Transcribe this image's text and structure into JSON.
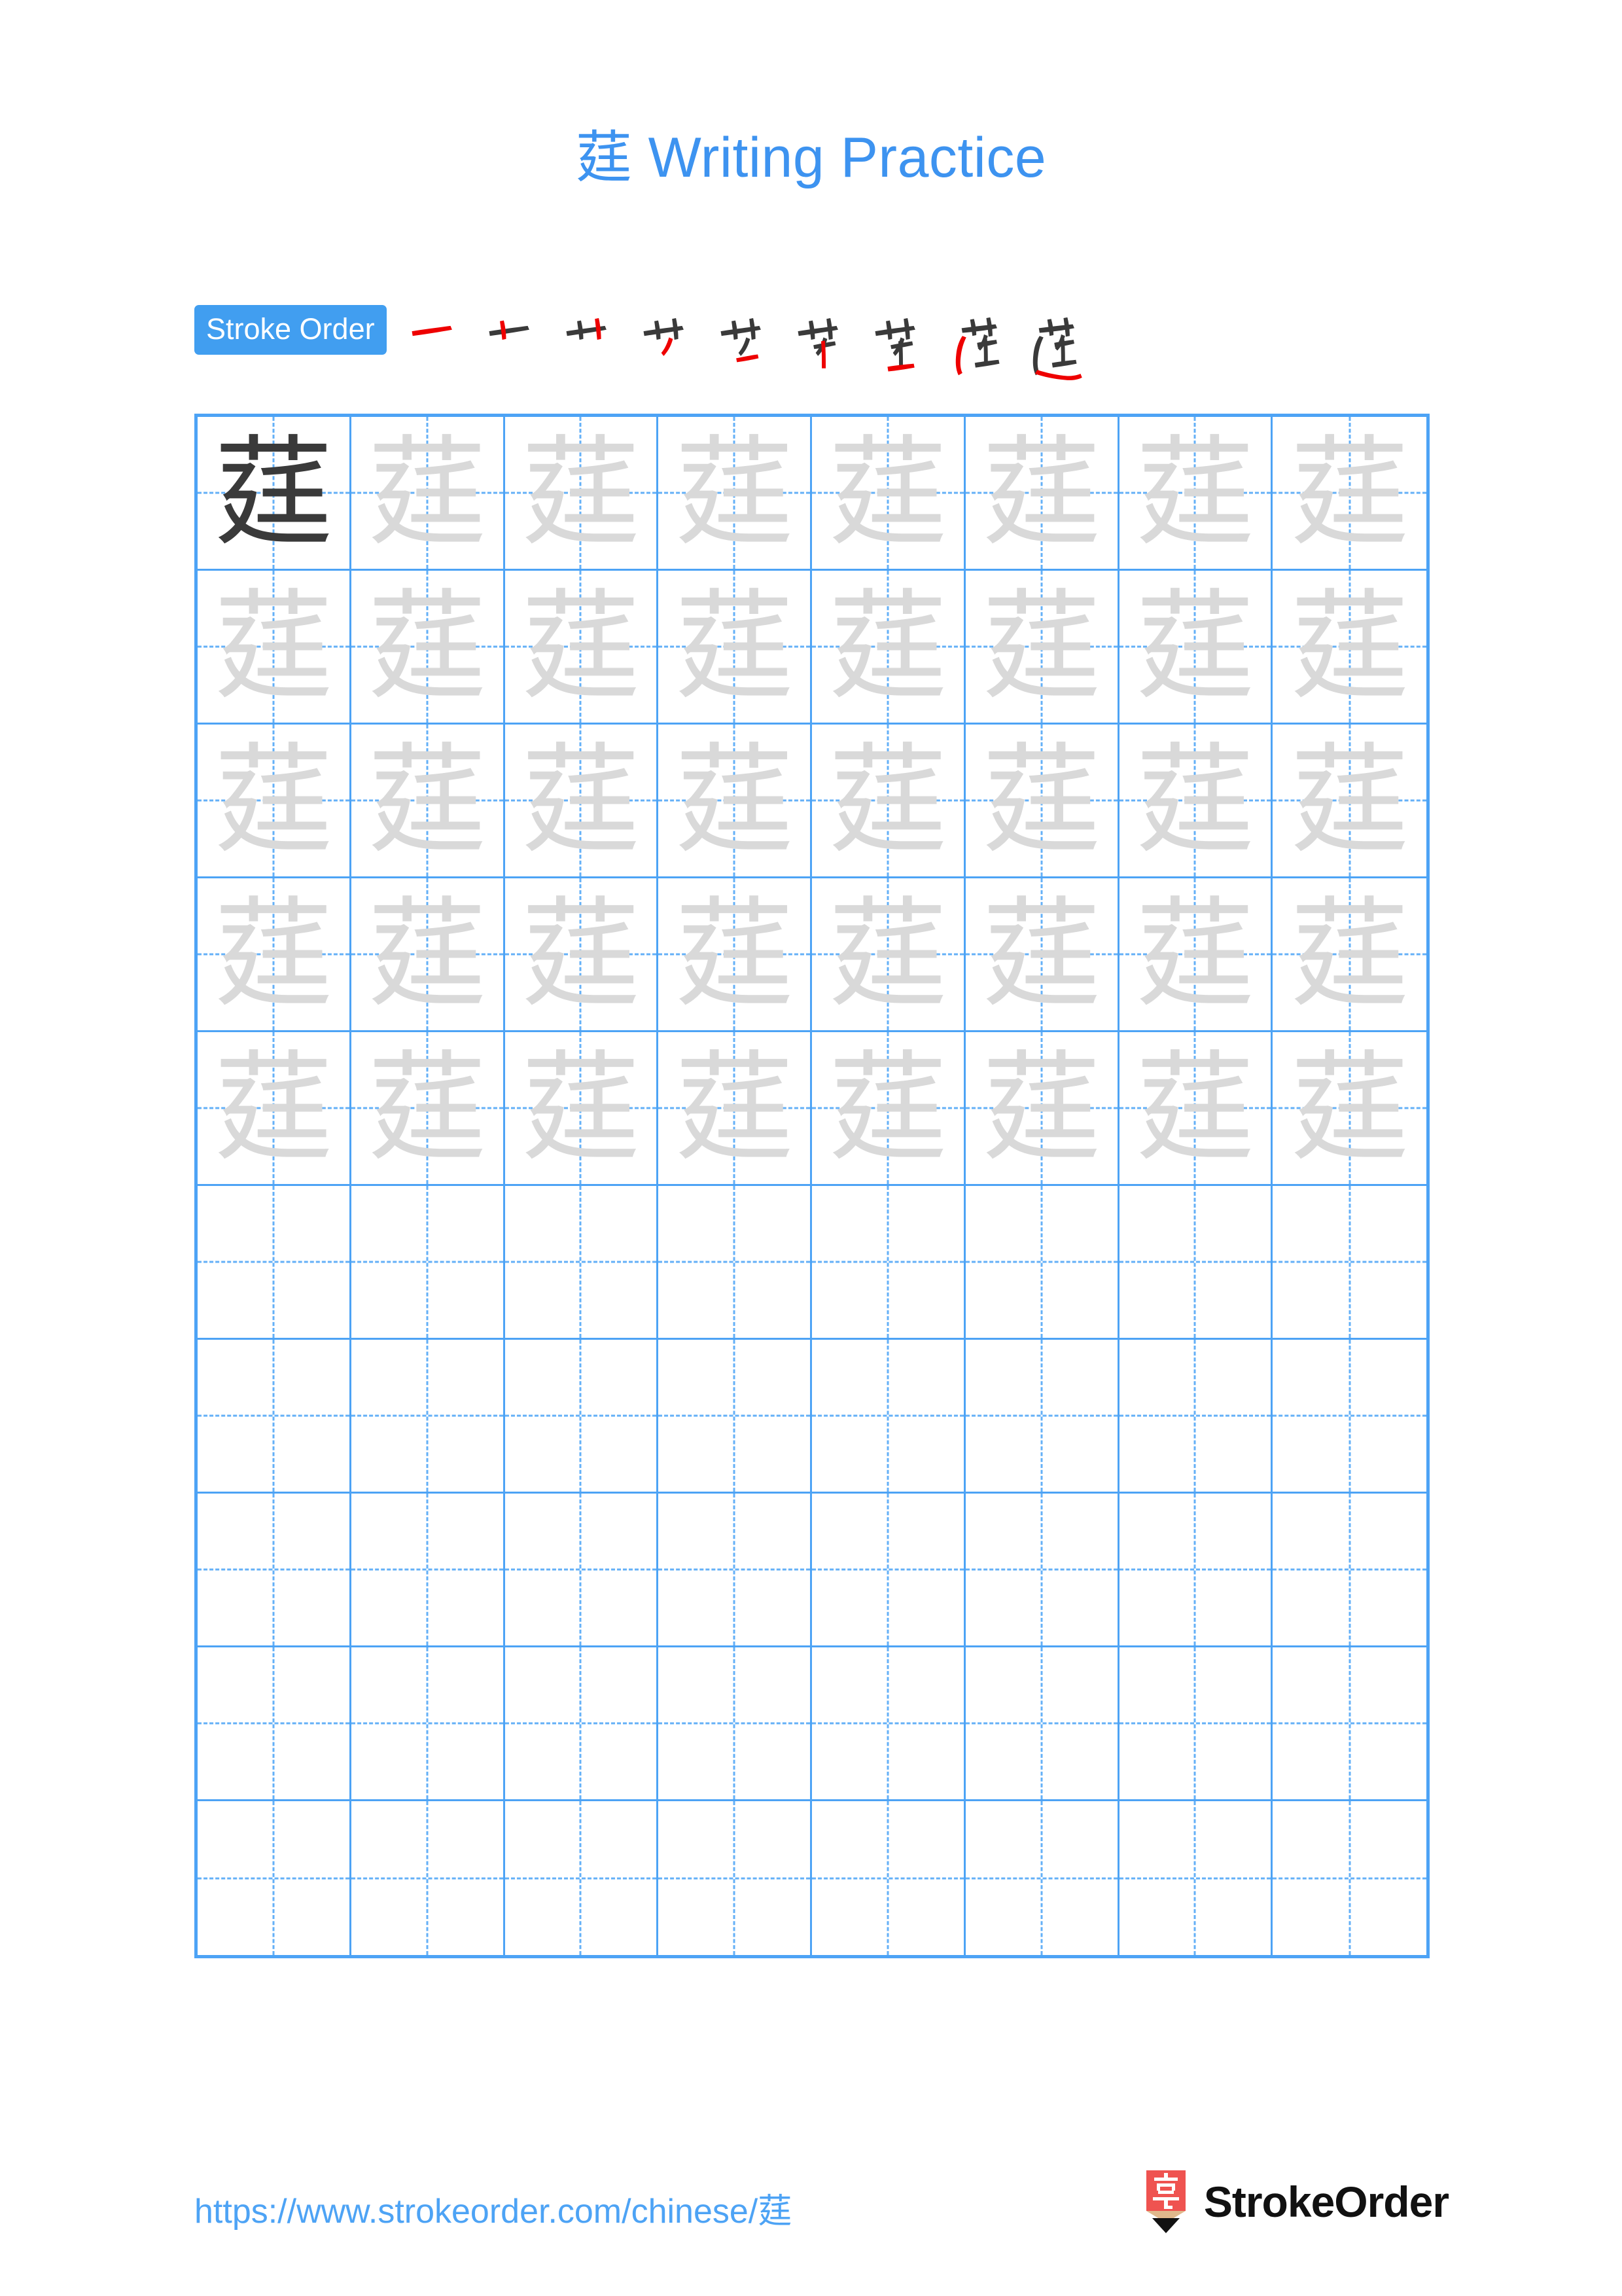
{
  "page": {
    "character": "莛",
    "title": "莛 Writing Practice",
    "title_character": "莛",
    "title_text": " Writing Practice",
    "background_color": "#ffffff",
    "accent_color": "#4da3f5"
  },
  "stroke_order": {
    "label": "Stroke Order",
    "badge_bg": "#419ef0",
    "badge_text_color": "#ffffff",
    "new_stroke_color": "#ee0000",
    "existing_stroke_color": "#3a3a3a",
    "total_strokes": 9,
    "steps": [
      {
        "index": 1,
        "partial": "一",
        "new_stroke": "héng (horizontal)"
      },
      {
        "index": 2,
        "partial": "十",
        "new_stroke": "shù (vertical)"
      },
      {
        "index": 3,
        "partial": "艹",
        "new_stroke": "shù (vertical)"
      },
      {
        "index": 4,
        "partial": "艹丿",
        "new_stroke": "piě (left-falling)"
      },
      {
        "index": 5,
        "partial": "芒",
        "new_stroke": "héng (horizontal)"
      },
      {
        "index": 6,
        "partial": "芉",
        "new_stroke": "shù (vertical)"
      },
      {
        "index": 7,
        "partial": "茾",
        "new_stroke": "héng (horizontal)"
      },
      {
        "index": 8,
        "partial": "莛",
        "new_stroke": "héng-zhé-piě-nà (廴 radical)"
      },
      {
        "index": 9,
        "partial": "莛",
        "new_stroke": "nà (right-falling)"
      }
    ]
  },
  "grid": {
    "columns": 8,
    "rows": 10,
    "border_color": "#4da3f5",
    "guide_color": "#64b0f7",
    "example_color": "#3a3a3a",
    "trace_color": "#d9d9d9",
    "filled_rows": 5,
    "empty_rows": 5,
    "cells": [
      [
        "dark",
        "light",
        "light",
        "light",
        "light",
        "light",
        "light",
        "light"
      ],
      [
        "light",
        "light",
        "light",
        "light",
        "light",
        "light",
        "light",
        "light"
      ],
      [
        "light",
        "light",
        "light",
        "light",
        "light",
        "light",
        "light",
        "light"
      ],
      [
        "light",
        "light",
        "light",
        "light",
        "light",
        "light",
        "light",
        "light"
      ],
      [
        "light",
        "light",
        "light",
        "light",
        "light",
        "light",
        "light",
        "light"
      ],
      [
        "empty",
        "empty",
        "empty",
        "empty",
        "empty",
        "empty",
        "empty",
        "empty"
      ],
      [
        "empty",
        "empty",
        "empty",
        "empty",
        "empty",
        "empty",
        "empty",
        "empty"
      ],
      [
        "empty",
        "empty",
        "empty",
        "empty",
        "empty",
        "empty",
        "empty",
        "empty"
      ],
      [
        "empty",
        "empty",
        "empty",
        "empty",
        "empty",
        "empty",
        "empty",
        "empty"
      ],
      [
        "empty",
        "empty",
        "empty",
        "empty",
        "empty",
        "empty",
        "empty",
        "empty"
      ]
    ]
  },
  "footer": {
    "url": "https://www.strokeorder.com/chinese/莛",
    "url_color": "#4da3f5",
    "brand_name": "StrokeOrder",
    "logo_character": "字",
    "logo_color": "#ef5350",
    "logo_wood_color": "#e0b98c"
  }
}
